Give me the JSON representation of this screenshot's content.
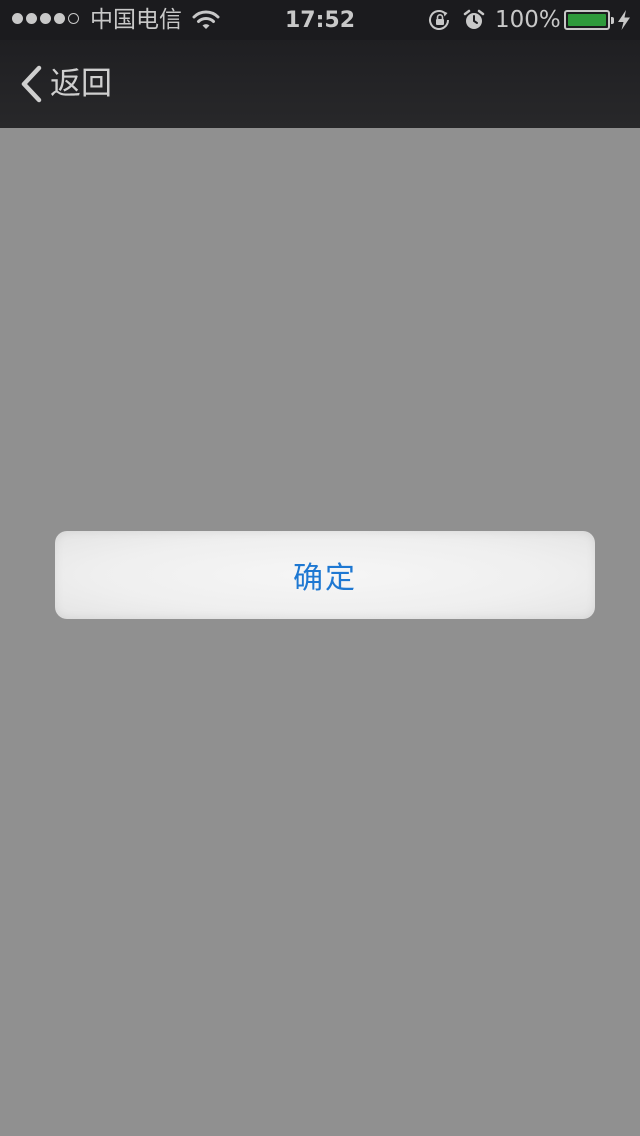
{
  "status_bar": {
    "carrier": "中国电信",
    "time": "17:52",
    "battery_percent": "100%",
    "battery_level": 1.0,
    "battery_color": "#2f9a3c",
    "signal_bars_filled": 4,
    "signal_bars_total": 5,
    "icons": [
      "wifi-icon",
      "rotation-lock-icon",
      "alarm-icon",
      "battery-icon",
      "charging-bolt-icon"
    ]
  },
  "nav_bar": {
    "back_label": "返回",
    "back_icon": "chevron-left-icon"
  },
  "main": {
    "confirm_label": "确定",
    "accent_color": "#1e78d2",
    "background_color": "#909090"
  }
}
